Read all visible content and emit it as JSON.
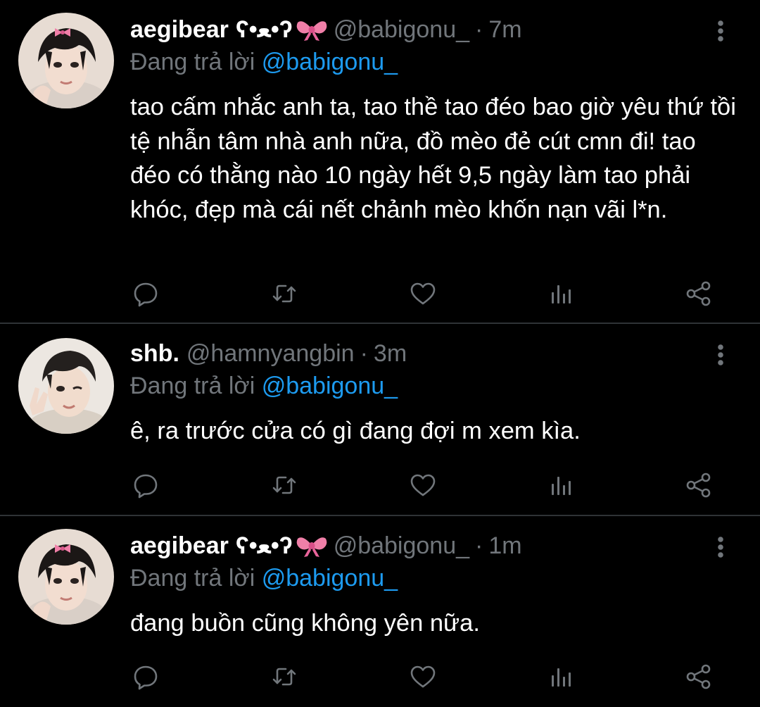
{
  "colors": {
    "background": "#000000",
    "divider": "#2f3336",
    "name": "#ffffff",
    "muted": "#71767b",
    "mention": "#1d9bf0",
    "icon": "#71767b",
    "bow": "#f07fa8"
  },
  "tweets": [
    {
      "author": {
        "name": "aegibear",
        "kaomoji": "ʕ•ﻌ•ʔ",
        "emoji_icon": "ribbon-bow-icon",
        "handle": "@babigonu_"
      },
      "dot": "·",
      "time": "7m",
      "reply_prefix": "Đang trả lời",
      "reply_to": "@babigonu_",
      "text": "tao cấm nhắc anh ta, tao thề tao đéo bao giờ yêu thứ tồi tệ nhẫn tâm nhà anh nữa, đồ mèo đẻ cút cmn đi! tao đéo có thằng nào 10 ngày hết 9,5 ngày làm tao phải khóc, đẹp mà cái nết chảnh mèo khốn nạn vãi l*n."
    },
    {
      "author": {
        "name": "shb.",
        "kaomoji": "",
        "emoji_icon": "",
        "handle": "@hamnyangbin"
      },
      "dot": "·",
      "time": "3m",
      "reply_prefix": "Đang trả lời",
      "reply_to": "@babigonu_",
      "text": "ê, ra trước cửa có gì đang đợi m xem kìa."
    },
    {
      "author": {
        "name": "aegibear",
        "kaomoji": "ʕ•ﻌ•ʔ",
        "emoji_icon": "ribbon-bow-icon",
        "handle": "@babigonu_"
      },
      "dot": "·",
      "time": "1m",
      "reply_prefix": "Đang trả lời",
      "reply_to": "@babigonu_",
      "text": "đang buồn cũng không yên nữa."
    }
  ]
}
